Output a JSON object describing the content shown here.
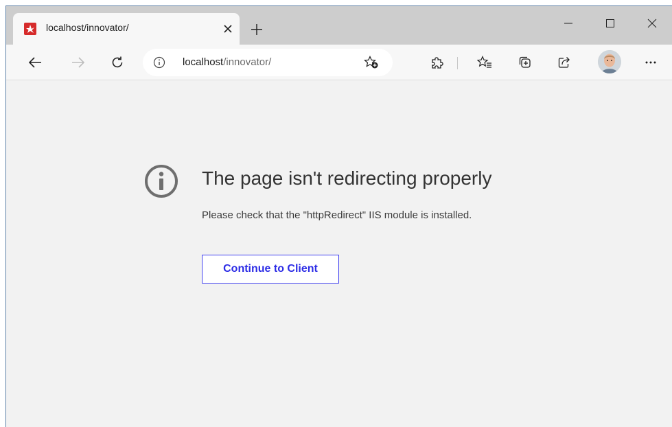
{
  "tab": {
    "title": "localhost/innovator/",
    "favicon": "aras-innovator-logo"
  },
  "address": {
    "host": "localhost",
    "path": "/innovator/"
  },
  "error": {
    "title": "The page isn't redirecting properly",
    "description": "Please check that the \"httpRedirect\" IIS module is installed.",
    "button_label": "Continue to Client"
  },
  "colors": {
    "accent": "#2d2de6",
    "favicon": "#d62b2b"
  }
}
